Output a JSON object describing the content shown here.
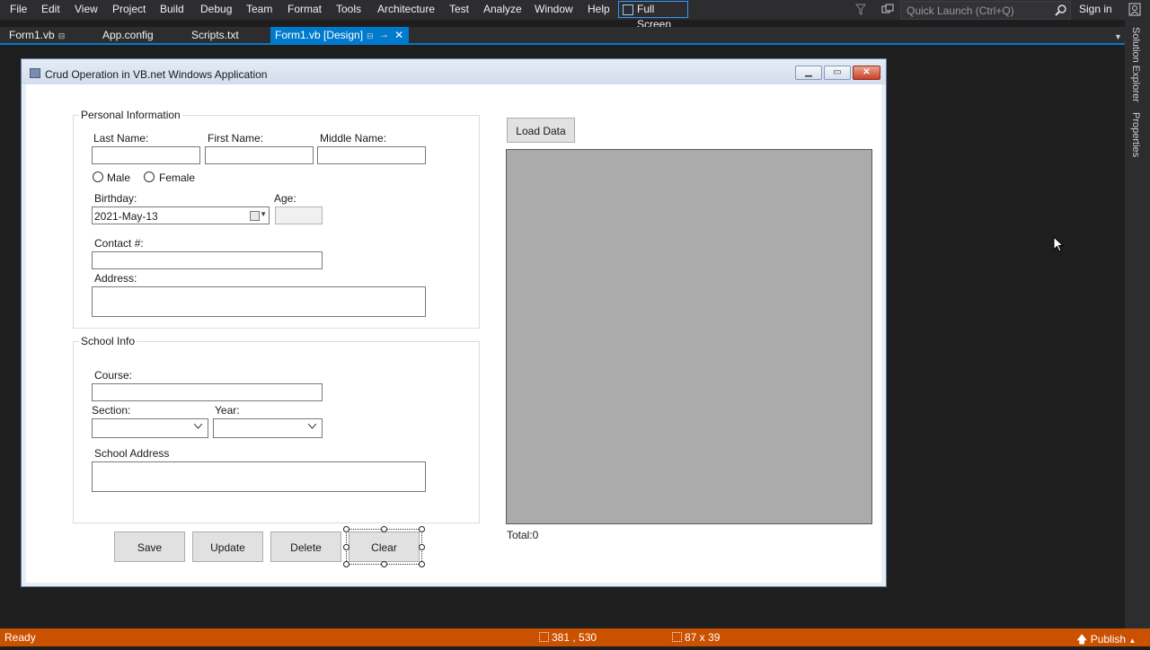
{
  "menu": {
    "items": [
      "File",
      "Edit",
      "View",
      "Project",
      "Build",
      "Debug",
      "Team",
      "Format",
      "Tools",
      "Architecture",
      "Test",
      "Analyze",
      "Window",
      "Help"
    ],
    "fullscreen_label": "Full Screen",
    "quick_launch_placeholder": "Quick Launch (Ctrl+Q)",
    "sign_in": "Sign in"
  },
  "tabs": [
    {
      "label": "Form1.vb",
      "pinned": true
    },
    {
      "label": "App.config"
    },
    {
      "label": "Scripts.txt"
    },
    {
      "label": "Form1.vb [Design]",
      "active": true
    }
  ],
  "right_rail": {
    "solution_explorer": "Solution Explorer",
    "properties": "Properties"
  },
  "form": {
    "title": "Crud Operation in VB.net Windows Application",
    "personal": {
      "group_title": "Personal Information",
      "last_name_label": "Last Name:",
      "first_name_label": "First Name:",
      "middle_name_label": "Middle Name:",
      "male_label": "Male",
      "female_label": "Female",
      "birthday_label": "Birthday:",
      "birthday_value": "2021-May-13",
      "age_label": "Age:",
      "contact_label": "Contact #:",
      "address_label": "Address:"
    },
    "school": {
      "group_title": "School Info",
      "course_label": "Course:",
      "section_label": "Section:",
      "year_label": "Year:",
      "school_address_label": "School Address"
    },
    "buttons": {
      "save": "Save",
      "update": "Update",
      "delete": "Delete",
      "clear": "Clear",
      "load_data": "Load Data"
    },
    "total_label": "Total:0"
  },
  "status": {
    "ready": "Ready",
    "position": "381 , 530",
    "size": "87 x 39",
    "publish": "Publish"
  },
  "colors": {
    "accent": "#007acc",
    "status_bar": "#ca5100",
    "menu_bg": "#2d2d30",
    "ide_bg": "#1e1e1e",
    "grid_bg": "#ababab"
  }
}
